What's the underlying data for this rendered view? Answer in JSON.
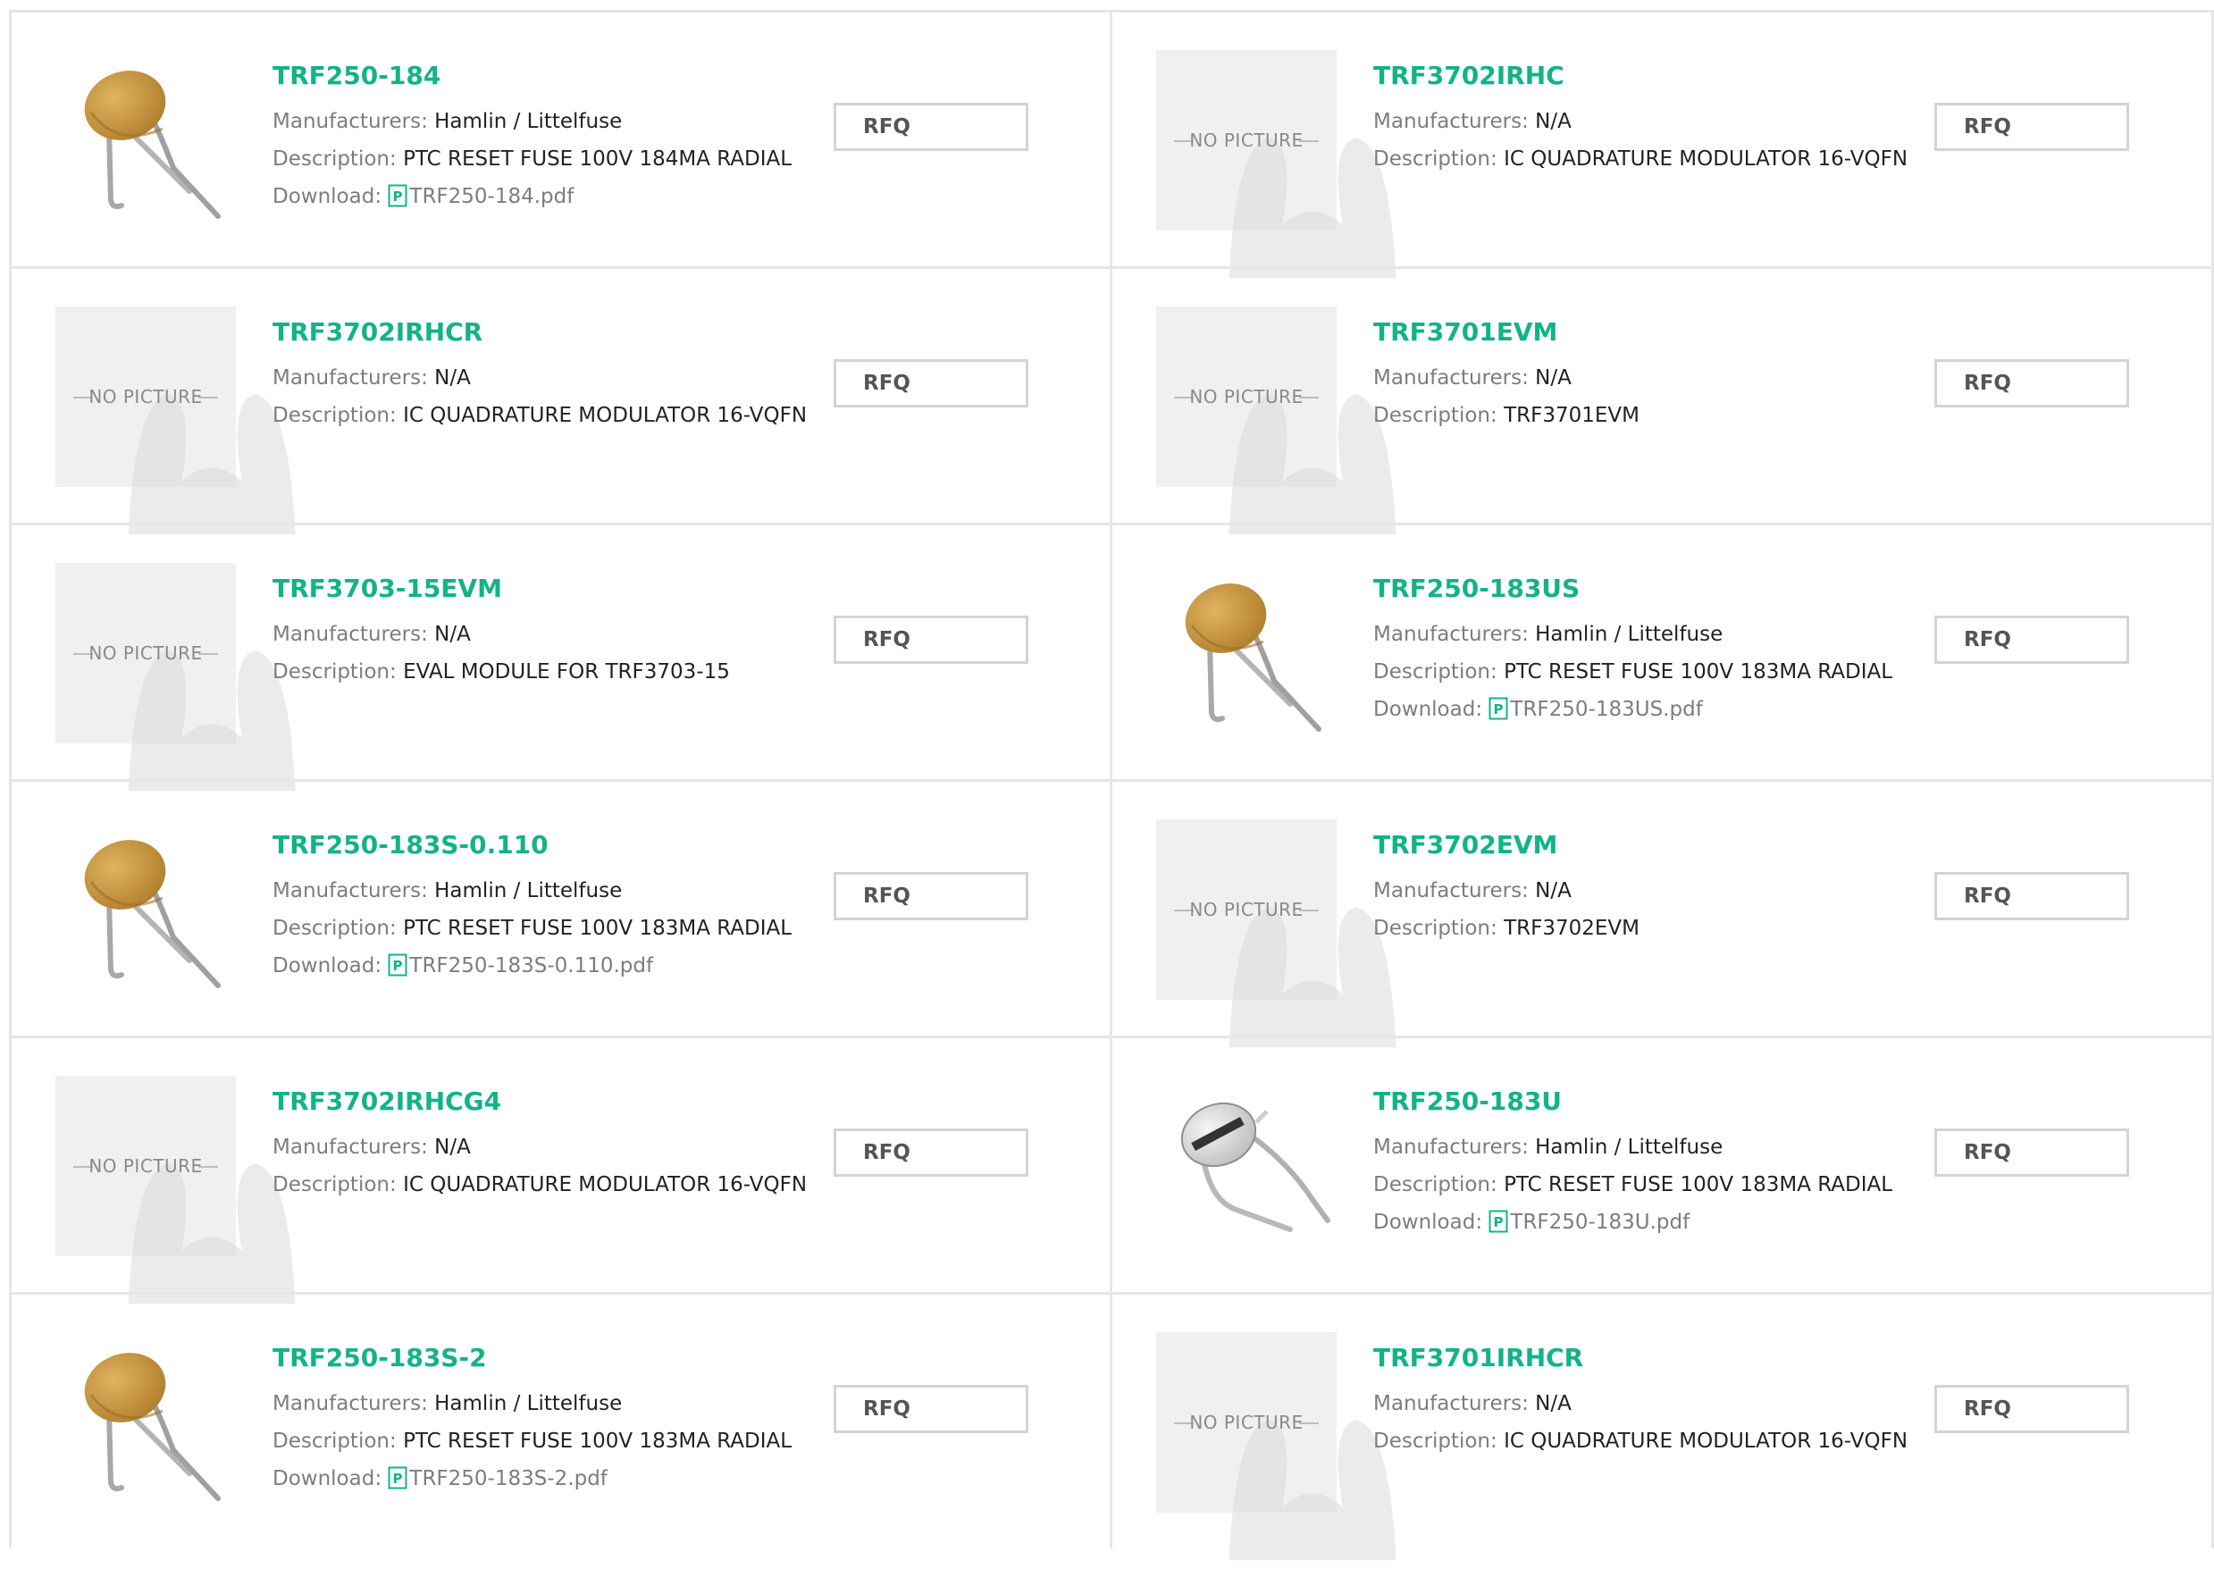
{
  "products": [
    {
      "part": "TRF250-184",
      "image": "fuse-orange",
      "manufacturer_label": "Manufacturers:",
      "manufacturer": "Hamlin / Littelfuse",
      "description_label": "Description:",
      "description": "PTC RESET FUSE 100V 184MA RADIAL",
      "download_label": "Download:",
      "pdf": "TRF250-184.pdf",
      "rfq": "RFQ"
    },
    {
      "part": "TRF3702IRHC",
      "image": "no-picture",
      "no_picture_text": "NO PICTURE",
      "manufacturer_label": "Manufacturers:",
      "manufacturer": "N/A",
      "description_label": "Description:",
      "description": "IC QUADRATURE MODULATOR 16-VQFN",
      "rfq": "RFQ"
    },
    {
      "part": "TRF3702IRHCR",
      "image": "no-picture",
      "no_picture_text": "NO PICTURE",
      "manufacturer_label": "Manufacturers:",
      "manufacturer": "N/A",
      "description_label": "Description:",
      "description": "IC QUADRATURE MODULATOR 16-VQFN",
      "rfq": "RFQ"
    },
    {
      "part": "TRF3701EVM",
      "image": "no-picture",
      "no_picture_text": "NO PICTURE",
      "manufacturer_label": "Manufacturers:",
      "manufacturer": "N/A",
      "description_label": "Description:",
      "description": "TRF3701EVM",
      "rfq": "RFQ"
    },
    {
      "part": "TRF3703-15EVM",
      "image": "no-picture",
      "no_picture_text": "NO PICTURE",
      "manufacturer_label": "Manufacturers:",
      "manufacturer": "N/A",
      "description_label": "Description:",
      "description": "EVAL MODULE FOR TRF3703-15",
      "rfq": "RFQ"
    },
    {
      "part": "TRF250-183US",
      "image": "fuse-orange",
      "manufacturer_label": "Manufacturers:",
      "manufacturer": "Hamlin / Littelfuse",
      "description_label": "Description:",
      "description": "PTC RESET FUSE 100V 183MA RADIAL",
      "download_label": "Download:",
      "pdf": "TRF250-183US.pdf",
      "rfq": "RFQ"
    },
    {
      "part": "TRF250-183S-0.110",
      "image": "fuse-orange",
      "manufacturer_label": "Manufacturers:",
      "manufacturer": "Hamlin / Littelfuse",
      "description_label": "Description:",
      "description": "PTC RESET FUSE 100V 183MA RADIAL",
      "download_label": "Download:",
      "pdf": "TRF250-183S-0.110.pdf",
      "rfq": "RFQ"
    },
    {
      "part": "TRF3702EVM",
      "image": "no-picture",
      "no_picture_text": "NO PICTURE",
      "manufacturer_label": "Manufacturers:",
      "manufacturer": "N/A",
      "description_label": "Description:",
      "description": "TRF3702EVM",
      "rfq": "RFQ"
    },
    {
      "part": "TRF3702IRHCG4",
      "image": "no-picture",
      "no_picture_text": "NO PICTURE",
      "manufacturer_label": "Manufacturers:",
      "manufacturer": "N/A",
      "description_label": "Description:",
      "description": "IC QUADRATURE MODULATOR 16-VQFN",
      "rfq": "RFQ"
    },
    {
      "part": "TRF250-183U",
      "image": "fuse-silver",
      "manufacturer_label": "Manufacturers:",
      "manufacturer": "Hamlin / Littelfuse",
      "description_label": "Description:",
      "description": "PTC RESET FUSE 100V 183MA RADIAL",
      "download_label": "Download:",
      "pdf": "TRF250-183U.pdf",
      "rfq": "RFQ"
    },
    {
      "part": "TRF250-183S-2",
      "image": "fuse-orange",
      "manufacturer_label": "Manufacturers:",
      "manufacturer": "Hamlin / Littelfuse",
      "description_label": "Description:",
      "description": "PTC RESET FUSE 100V 183MA RADIAL",
      "download_label": "Download:",
      "pdf": "TRF250-183S-2.pdf",
      "rfq": "RFQ"
    },
    {
      "part": "TRF3701IRHCR",
      "image": "no-picture",
      "no_picture_text": "NO PICTURE",
      "manufacturer_label": "Manufacturers:",
      "manufacturer": "N/A",
      "description_label": "Description:",
      "description": "IC QUADRATURE MODULATOR 16-VQFN",
      "rfq": "RFQ"
    }
  ],
  "colors": {
    "part_number": "#12b388",
    "label": "#7d7d7d",
    "value": "#222222",
    "border": "#e6e6e6",
    "rfq_border": "#d4d4d4",
    "placeholder_bg": "#f0f0f0",
    "fuse_orange": "#c99a45",
    "fuse_silver": "#d8d8d8"
  }
}
